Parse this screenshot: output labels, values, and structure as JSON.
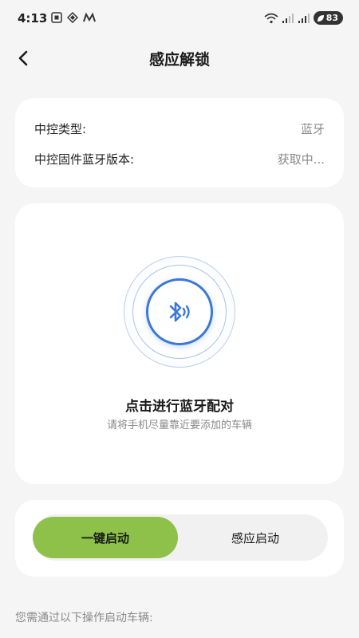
{
  "status_bar": {
    "time": "4:13",
    "battery": "83"
  },
  "header": {
    "title": "感应解锁"
  },
  "info": {
    "rows": [
      {
        "label": "中控类型:",
        "value": "蓝牙"
      },
      {
        "label": "中控固件蓝牙版本:",
        "value": "获取中..."
      }
    ]
  },
  "pairing": {
    "title": "点击进行蓝牙配对",
    "subtitle": "请将手机尽量靠近要添加的车辆"
  },
  "start_mode": {
    "options": [
      {
        "label": "一键启动",
        "selected": true
      },
      {
        "label": "感应启动",
        "selected": false
      }
    ]
  },
  "instructions": {
    "text": "您需通过以下操作启动车辆:"
  },
  "colors": {
    "accent_green": "#8dc149",
    "bluetooth_blue": "#3b78d8",
    "background": "#f5f5f5"
  }
}
